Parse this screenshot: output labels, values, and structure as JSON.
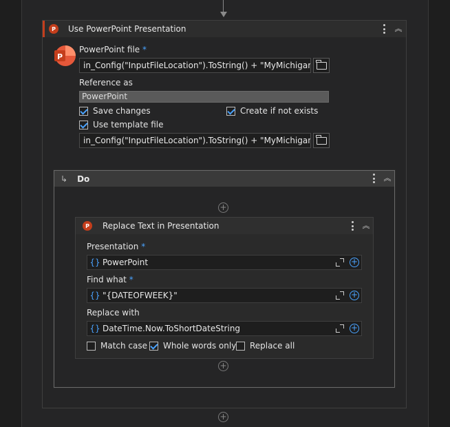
{
  "outer": {
    "title": "Use PowerPoint Presentation",
    "file_label": "PowerPoint file",
    "required_mark": "*",
    "file_value": "in_Config(\"InputFileLocation\").ToString() + \"MyMichigan.pptr",
    "reference_label": "Reference as",
    "reference_value": "PowerPoint",
    "save_changes": {
      "label": "Save changes",
      "checked": true
    },
    "create_if_not_exists": {
      "label": "Create if not exists",
      "checked": true
    },
    "use_template": {
      "label": "Use template file",
      "checked": true
    },
    "template_value": "in_Config(\"InputFileLocation\").ToString() + \"MyMichigan.pptr",
    "badge": "P"
  },
  "do_block": {
    "arrow": "↳",
    "title": "Do"
  },
  "replace": {
    "title": "Replace Text in Presentation",
    "badge": "P",
    "presentation_label": "Presentation",
    "presentation_value": "PowerPoint",
    "find_label": "Find what",
    "find_value": "\"{DATEOFWEEK}\"",
    "replace_label": "Replace with",
    "replace_value": "DateTime.Now.ToShortDateString",
    "brace": "{}",
    "match_case": {
      "label": "Match case",
      "checked": false
    },
    "whole_words": {
      "label": "Whole words only",
      "checked": true
    },
    "replace_all": {
      "label": "Replace all",
      "checked": false
    }
  },
  "colors": {
    "accent": "#4aa3ff",
    "powerpoint": "#c43e1c"
  }
}
